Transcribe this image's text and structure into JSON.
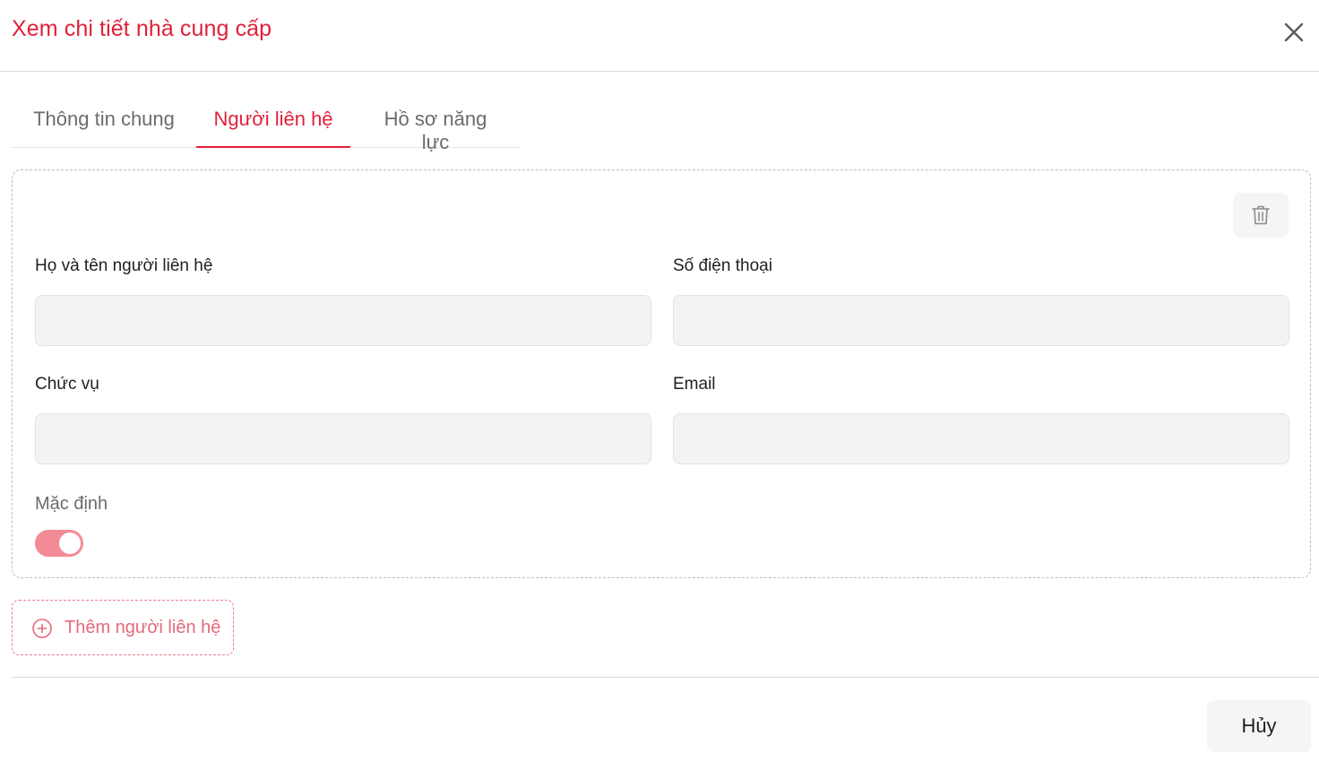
{
  "dialog": {
    "title": "Xem chi tiết nhà cung cấp",
    "close_icon": "close-icon"
  },
  "tabs": [
    {
      "label": "Thông tin chung",
      "active": false
    },
    {
      "label": "Người liên hệ",
      "active": true
    },
    {
      "label": "Hồ sơ năng lực",
      "active": false
    }
  ],
  "contact": {
    "delete_icon": "trash-icon",
    "name_label": "Họ và tên người liên hệ",
    "name_value": "",
    "phone_label": "Số điện thoại",
    "phone_value": "",
    "position_label": "Chức vụ",
    "position_value": "",
    "email_label": "Email",
    "email_value": "",
    "default_label": "Mặc định",
    "default_on": true
  },
  "add_contact": {
    "label": "Thêm người liên hệ",
    "icon": "plus-circle-icon"
  },
  "footer": {
    "cancel_label": "Hủy"
  },
  "colors": {
    "accent": "#e0213a",
    "toggle_on": "#f28b96",
    "add_button": "#e66a79",
    "input_bg": "#f2f3f3"
  }
}
